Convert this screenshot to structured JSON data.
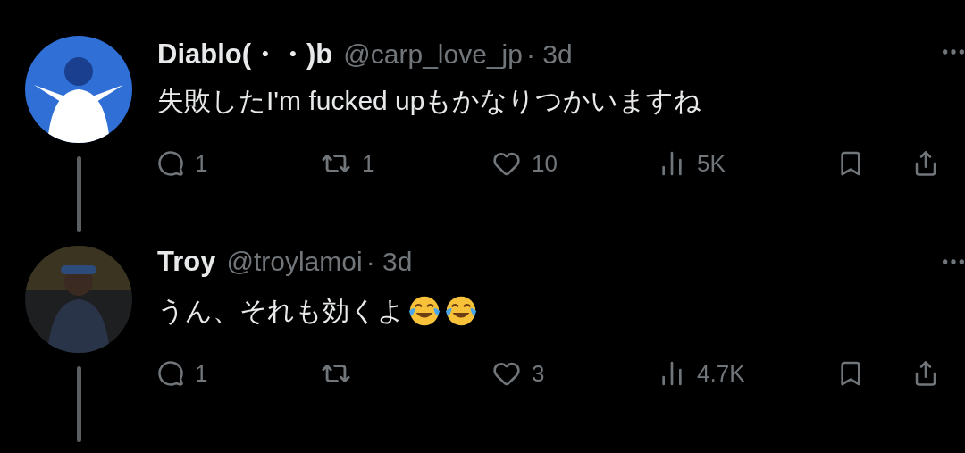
{
  "tweets": [
    {
      "name": "Diablo(・・)b",
      "handle": "@carp_love_jp",
      "time": "· 3d",
      "text": "失敗したI'm fucked upもかなりつかいますね",
      "stats": {
        "replies": "1",
        "reposts": "1",
        "likes": "10",
        "views": "5K"
      }
    },
    {
      "name": "Troy",
      "handle": "@troylamoi",
      "time": "· 3d",
      "text": "うん、それも効くよ",
      "emojis": [
        {
          "kind": "tears-of-joy"
        },
        {
          "kind": "tears-of-joy"
        }
      ],
      "stats": {
        "replies": "1",
        "likes": "3",
        "views": "4.7K"
      }
    }
  ]
}
